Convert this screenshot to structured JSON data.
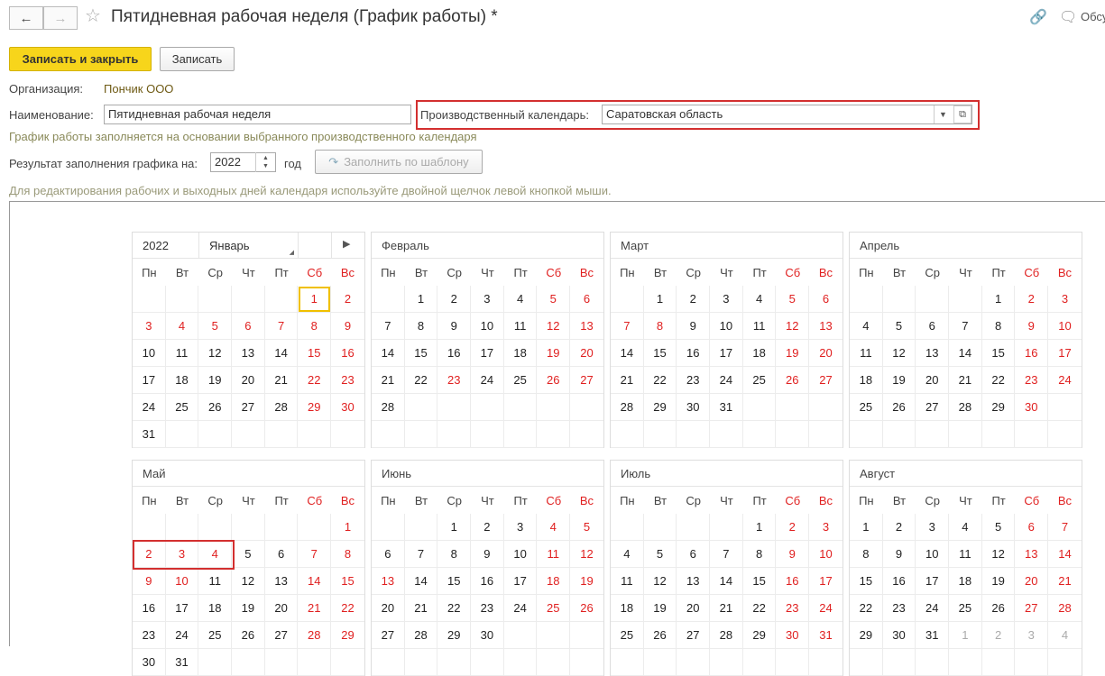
{
  "header": {
    "title": "Пятидневная рабочая неделя (График работы) *",
    "back_icon": "←",
    "forward_icon": "→",
    "star_icon": "☆",
    "link_icon": "🔗",
    "discuss_icon": "🗨",
    "discuss_label": "Обсудить"
  },
  "toolbar": {
    "save_close_label": "Записать и закрыть",
    "save_label": "Записать"
  },
  "form": {
    "org_label": "Организация:",
    "org_value": "Пончик ООО",
    "name_label": "Наименование:",
    "name_value": "Пятидневная рабочая неделя",
    "calendar_label": "Производственный календарь:",
    "calendar_value": "Саратовская область",
    "calendar_hint": "График работы заполняется на основании выбранного производственного календаря",
    "result_label": "Результат заполнения графика на:",
    "year_value": "2022",
    "year_unit": "год",
    "fill_button": "Заполнить по шаблону",
    "edit_hint": "Для редактирования рабочих и выходных дней календаря используйте двойной щелчок левой кнопкой мыши."
  },
  "calendar": {
    "year": "2022",
    "weekdays": [
      "Пн",
      "Вт",
      "Ср",
      "Чт",
      "Пт",
      "Сб",
      "Вс"
    ],
    "weekend_color": "#e02020",
    "months": [
      {
        "name": "Январь",
        "start": 5,
        "days": 31,
        "holidays": [
          3,
          4,
          5,
          6,
          7
        ]
      },
      {
        "name": "Февраль",
        "start": 1,
        "days": 28,
        "holidays": [
          23
        ]
      },
      {
        "name": "Март",
        "start": 1,
        "days": 31,
        "holidays": [
          7,
          8
        ]
      },
      {
        "name": "Апрель",
        "start": 4,
        "days": 30,
        "holidays": []
      },
      {
        "name": "Май",
        "start": 6,
        "days": 31,
        "holidays": [
          2,
          3,
          4,
          9,
          10
        ]
      },
      {
        "name": "Июнь",
        "start": 2,
        "days": 30,
        "holidays": [
          13
        ]
      },
      {
        "name": "Июль",
        "start": 4,
        "days": 31,
        "holidays": []
      },
      {
        "name": "Август",
        "start": 0,
        "days": 31,
        "holidays": []
      }
    ]
  }
}
